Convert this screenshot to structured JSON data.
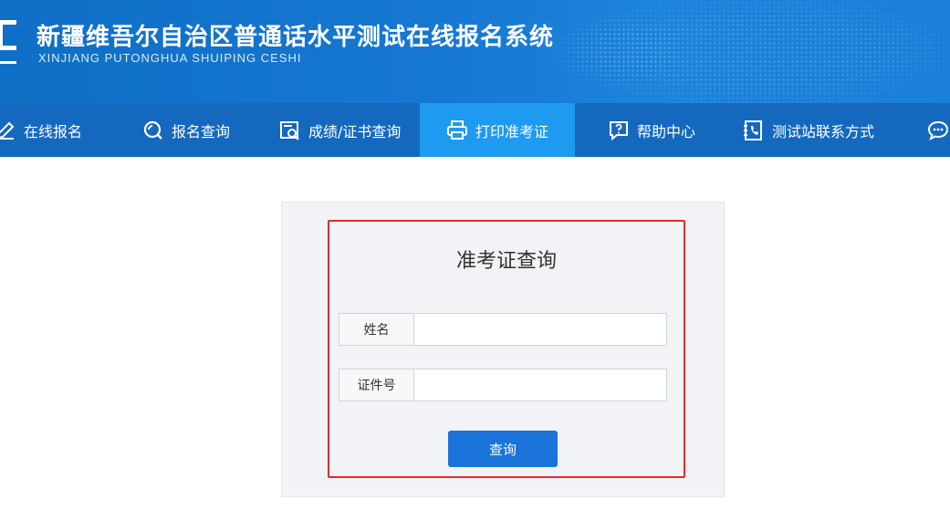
{
  "header": {
    "title": "新疆维吾尔自治区普通话水平测试在线报名系统",
    "subtitle": "XINJIANG PUTONGHUA SHUIPING CESHI"
  },
  "nav": {
    "items": [
      {
        "label": "在线报名",
        "icon": "edit-icon"
      },
      {
        "label": "报名查询",
        "icon": "search-icon"
      },
      {
        "label": "成绩/证书查询",
        "icon": "certificate-search-icon"
      },
      {
        "label": "打印准考证",
        "icon": "printer-icon",
        "active": true
      },
      {
        "label": "帮助中心",
        "icon": "help-icon"
      },
      {
        "label": "测试站联系方式",
        "icon": "phone-book-icon"
      },
      {
        "label": "",
        "icon": "chat-icon"
      }
    ]
  },
  "form": {
    "title": "准考证查询",
    "name_label": "姓名",
    "name_value": "",
    "id_label": "证件号",
    "id_value": "",
    "submit_label": "查询"
  },
  "colors": {
    "banner": "#1677d2",
    "nav": "#1469bf",
    "nav_active": "#1e9bf0",
    "highlight_box": "#e12b2b",
    "button": "#1a73d9"
  }
}
